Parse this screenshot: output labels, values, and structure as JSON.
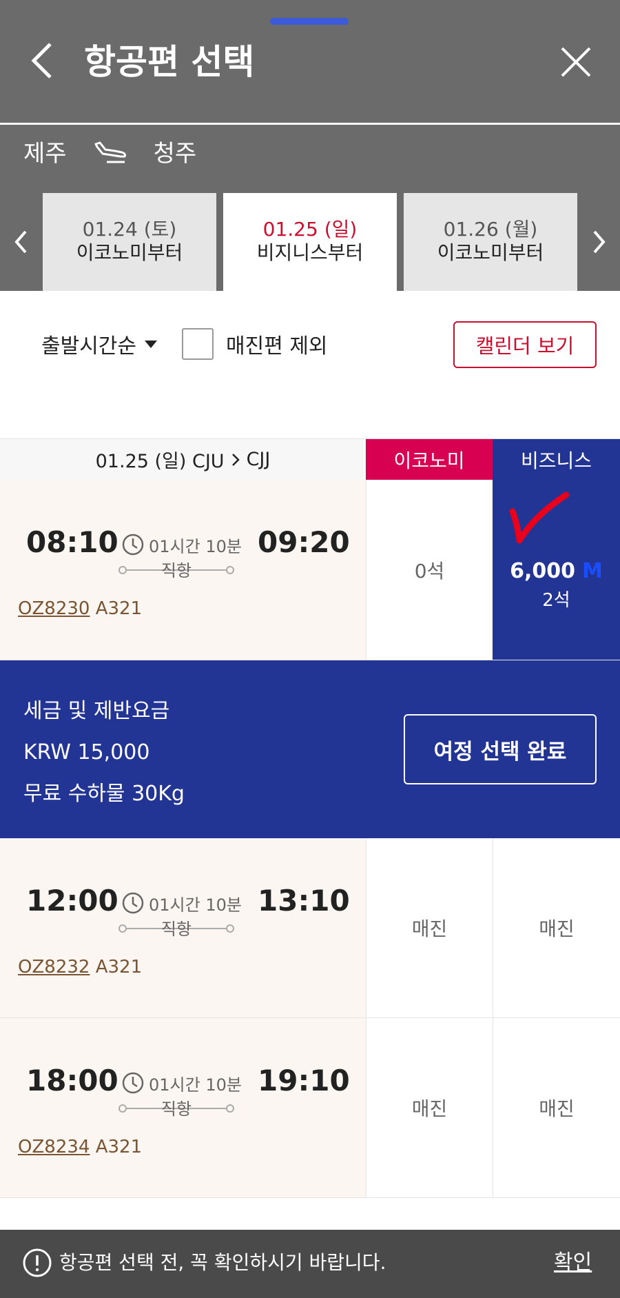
{
  "header": {
    "title": "항공편 선택",
    "origin": "제주",
    "destination": "청주"
  },
  "date_tabs": [
    {
      "date": "01.24 (토)",
      "class_from": "이코노미부터"
    },
    {
      "date": "01.25 (일)",
      "class_from": "비지니스부터",
      "active": true
    },
    {
      "date": "01.26 (월)",
      "class_from": "이코노미부터"
    }
  ],
  "filter": {
    "sort_label": "출발시간순",
    "exclude_soldout_label": "매진편 제외",
    "exclude_soldout_checked": false,
    "calendar_button": "캘린더 보기"
  },
  "table": {
    "route_date": "01.25 (일) CJU",
    "route_dest": "CJJ",
    "col_economy": "이코노미",
    "col_business": "비즈니스"
  },
  "flights": [
    {
      "dep": "08:10",
      "arr": "09:20",
      "duration": "01시간 10분",
      "type": "직항",
      "flight_no": "OZ8230",
      "aircraft": "A321",
      "economy": "0석",
      "business_price": "6,000",
      "business_unit": "M",
      "business_seats": "2석",
      "selected": true
    },
    {
      "dep": "12:00",
      "arr": "13:10",
      "duration": "01시간 10분",
      "type": "직항",
      "flight_no": "OZ8232",
      "aircraft": "A321",
      "economy": "매진",
      "business": "매진"
    },
    {
      "dep": "18:00",
      "arr": "19:10",
      "duration": "01시간 10분",
      "type": "직항",
      "flight_no": "OZ8234",
      "aircraft": "A321",
      "economy": "매진",
      "business": "매진"
    }
  ],
  "summary": {
    "tax_label": "세금 및 제반요금",
    "tax_amount": "KRW 15,000",
    "baggage": "무료 수하물 30Kg",
    "complete_button": "여정 선택 완료"
  },
  "notice": {
    "message": "항공편 선택 전, 꼭 확인하시기 바랍니다.",
    "confirm": "확인"
  },
  "colors": {
    "header_bg": "#6b6b6b",
    "accent_red": "#c8102e",
    "economy_header": "#d80050",
    "business_navy": "#233594",
    "check_mark": "#e8001c"
  }
}
